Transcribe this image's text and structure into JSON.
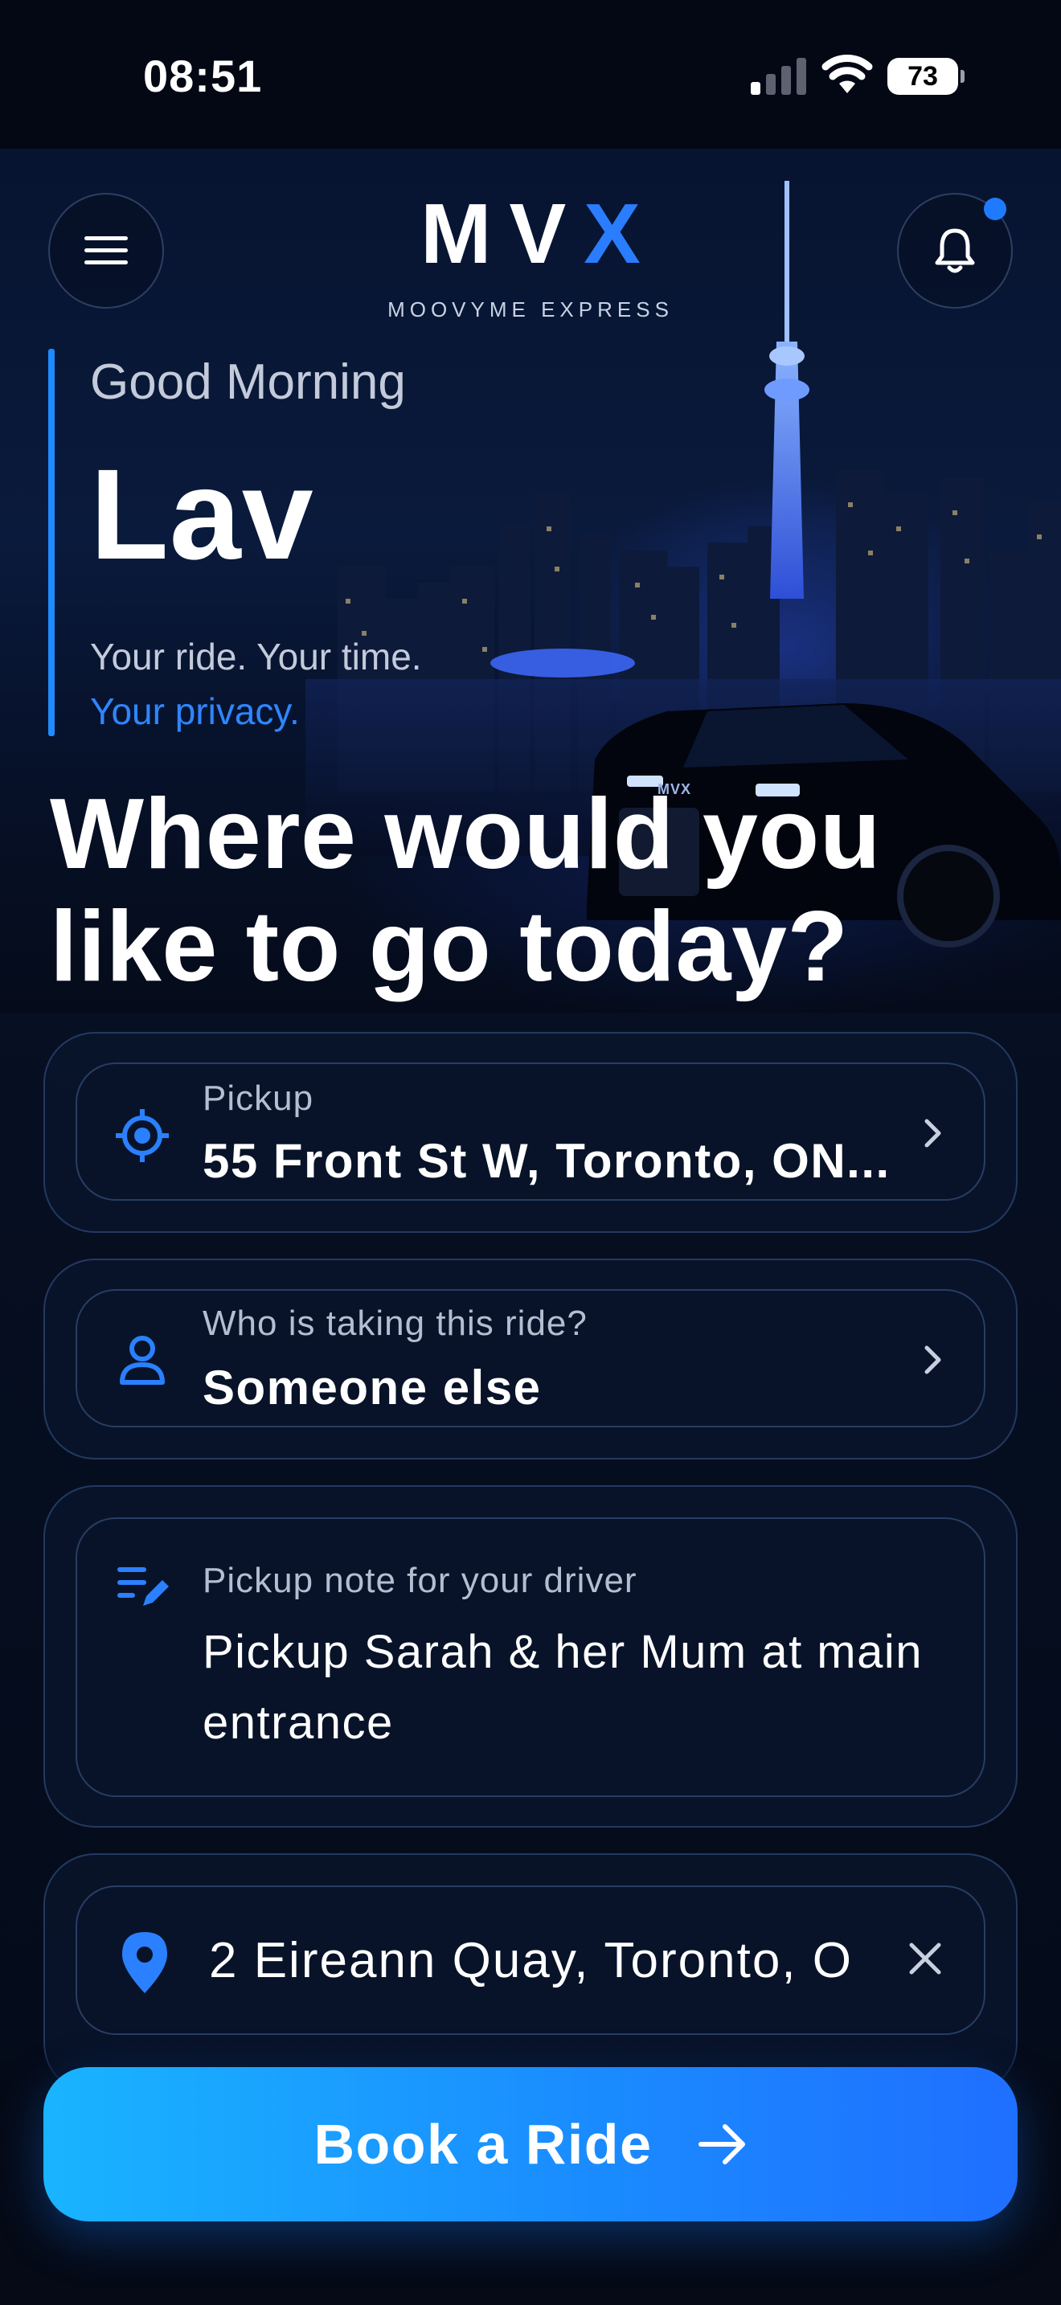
{
  "status_bar": {
    "time": "08:51",
    "battery": "73"
  },
  "header": {
    "logo_main": "MV",
    "logo_accent": "X",
    "logo_subtitle": "MOOVYME EXPRESS",
    "accent_color": "#2a7dff"
  },
  "hero": {
    "greeting": "Good Morning",
    "user_name": "Lav",
    "tagline_line1": "Your ride. Your time.",
    "tagline_line2": "Your privacy.",
    "car_badge": "MVX"
  },
  "headline": "Where would you like to go today?",
  "pickup": {
    "label": "Pickup",
    "value": "55 Front St W, Toronto, ON..."
  },
  "rider": {
    "label": "Who is taking this ride?",
    "value": "Someone else"
  },
  "note": {
    "label": "Pickup note for your driver",
    "value": "Pickup Sarah & her Mum at main entrance"
  },
  "destination": {
    "value": "2 Eireann Quay, Toronto, O"
  },
  "book_button": {
    "label": "Book a Ride"
  }
}
